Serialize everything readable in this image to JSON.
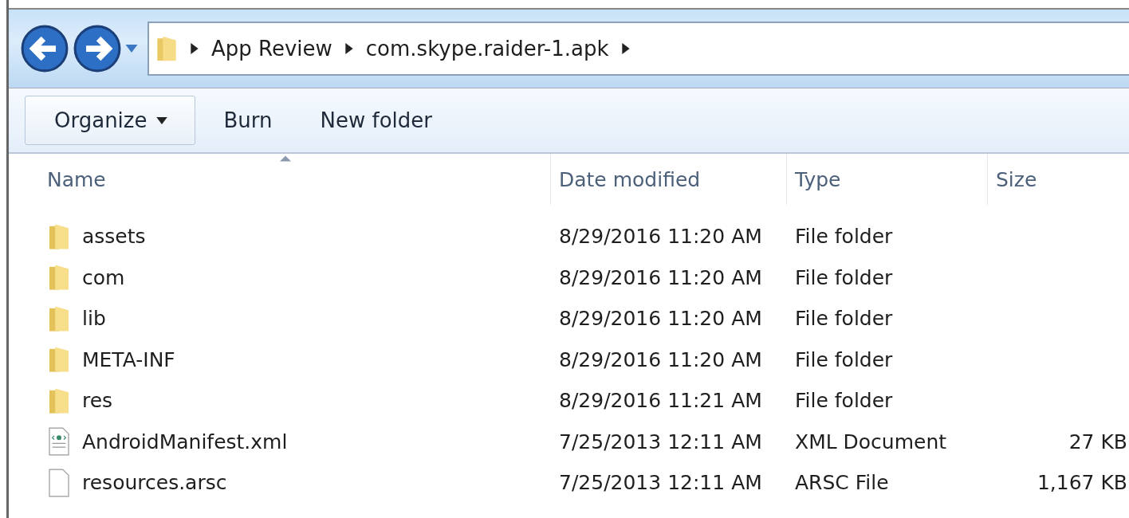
{
  "breadcrumb": [
    "App Review",
    "com.skype.raider-1.apk"
  ],
  "toolbar": [
    {
      "label": "Organize",
      "kind": "menu"
    },
    {
      "label": "Burn",
      "kind": "plain"
    },
    {
      "label": "New folder",
      "kind": "plain"
    }
  ],
  "columns": [
    {
      "label": "Name",
      "sorted": true
    },
    {
      "label": "Date modified",
      "sorted": false
    },
    {
      "label": "Type",
      "sorted": false
    },
    {
      "label": "Size",
      "sorted": false
    }
  ],
  "rows": [
    {
      "kind": "folder",
      "name": "assets",
      "date": "8/29/2016 11:20 AM",
      "type": "File folder"
    },
    {
      "kind": "folder",
      "name": "com",
      "date": "8/29/2016 11:20 AM",
      "type": "File folder"
    },
    {
      "kind": "folder",
      "name": "lib",
      "date": "8/29/2016 11:20 AM",
      "type": "File folder"
    },
    {
      "kind": "folder",
      "name": "META-INF",
      "date": "8/29/2016 11:20 AM",
      "type": "File folder"
    },
    {
      "kind": "folder",
      "name": "res",
      "date": "8/29/2016 11:21 AM",
      "type": "File folder"
    },
    {
      "kind": "xml",
      "name": "AndroidManifest.xml",
      "date": "7/25/2013 12:11 AM",
      "type": "XML Document",
      "size": "27 KB"
    },
    {
      "kind": "file",
      "name": "resources.arsc",
      "date": "7/25/2013 12:11 AM",
      "type": "ARSC File",
      "size": "1,167 KB"
    }
  ]
}
